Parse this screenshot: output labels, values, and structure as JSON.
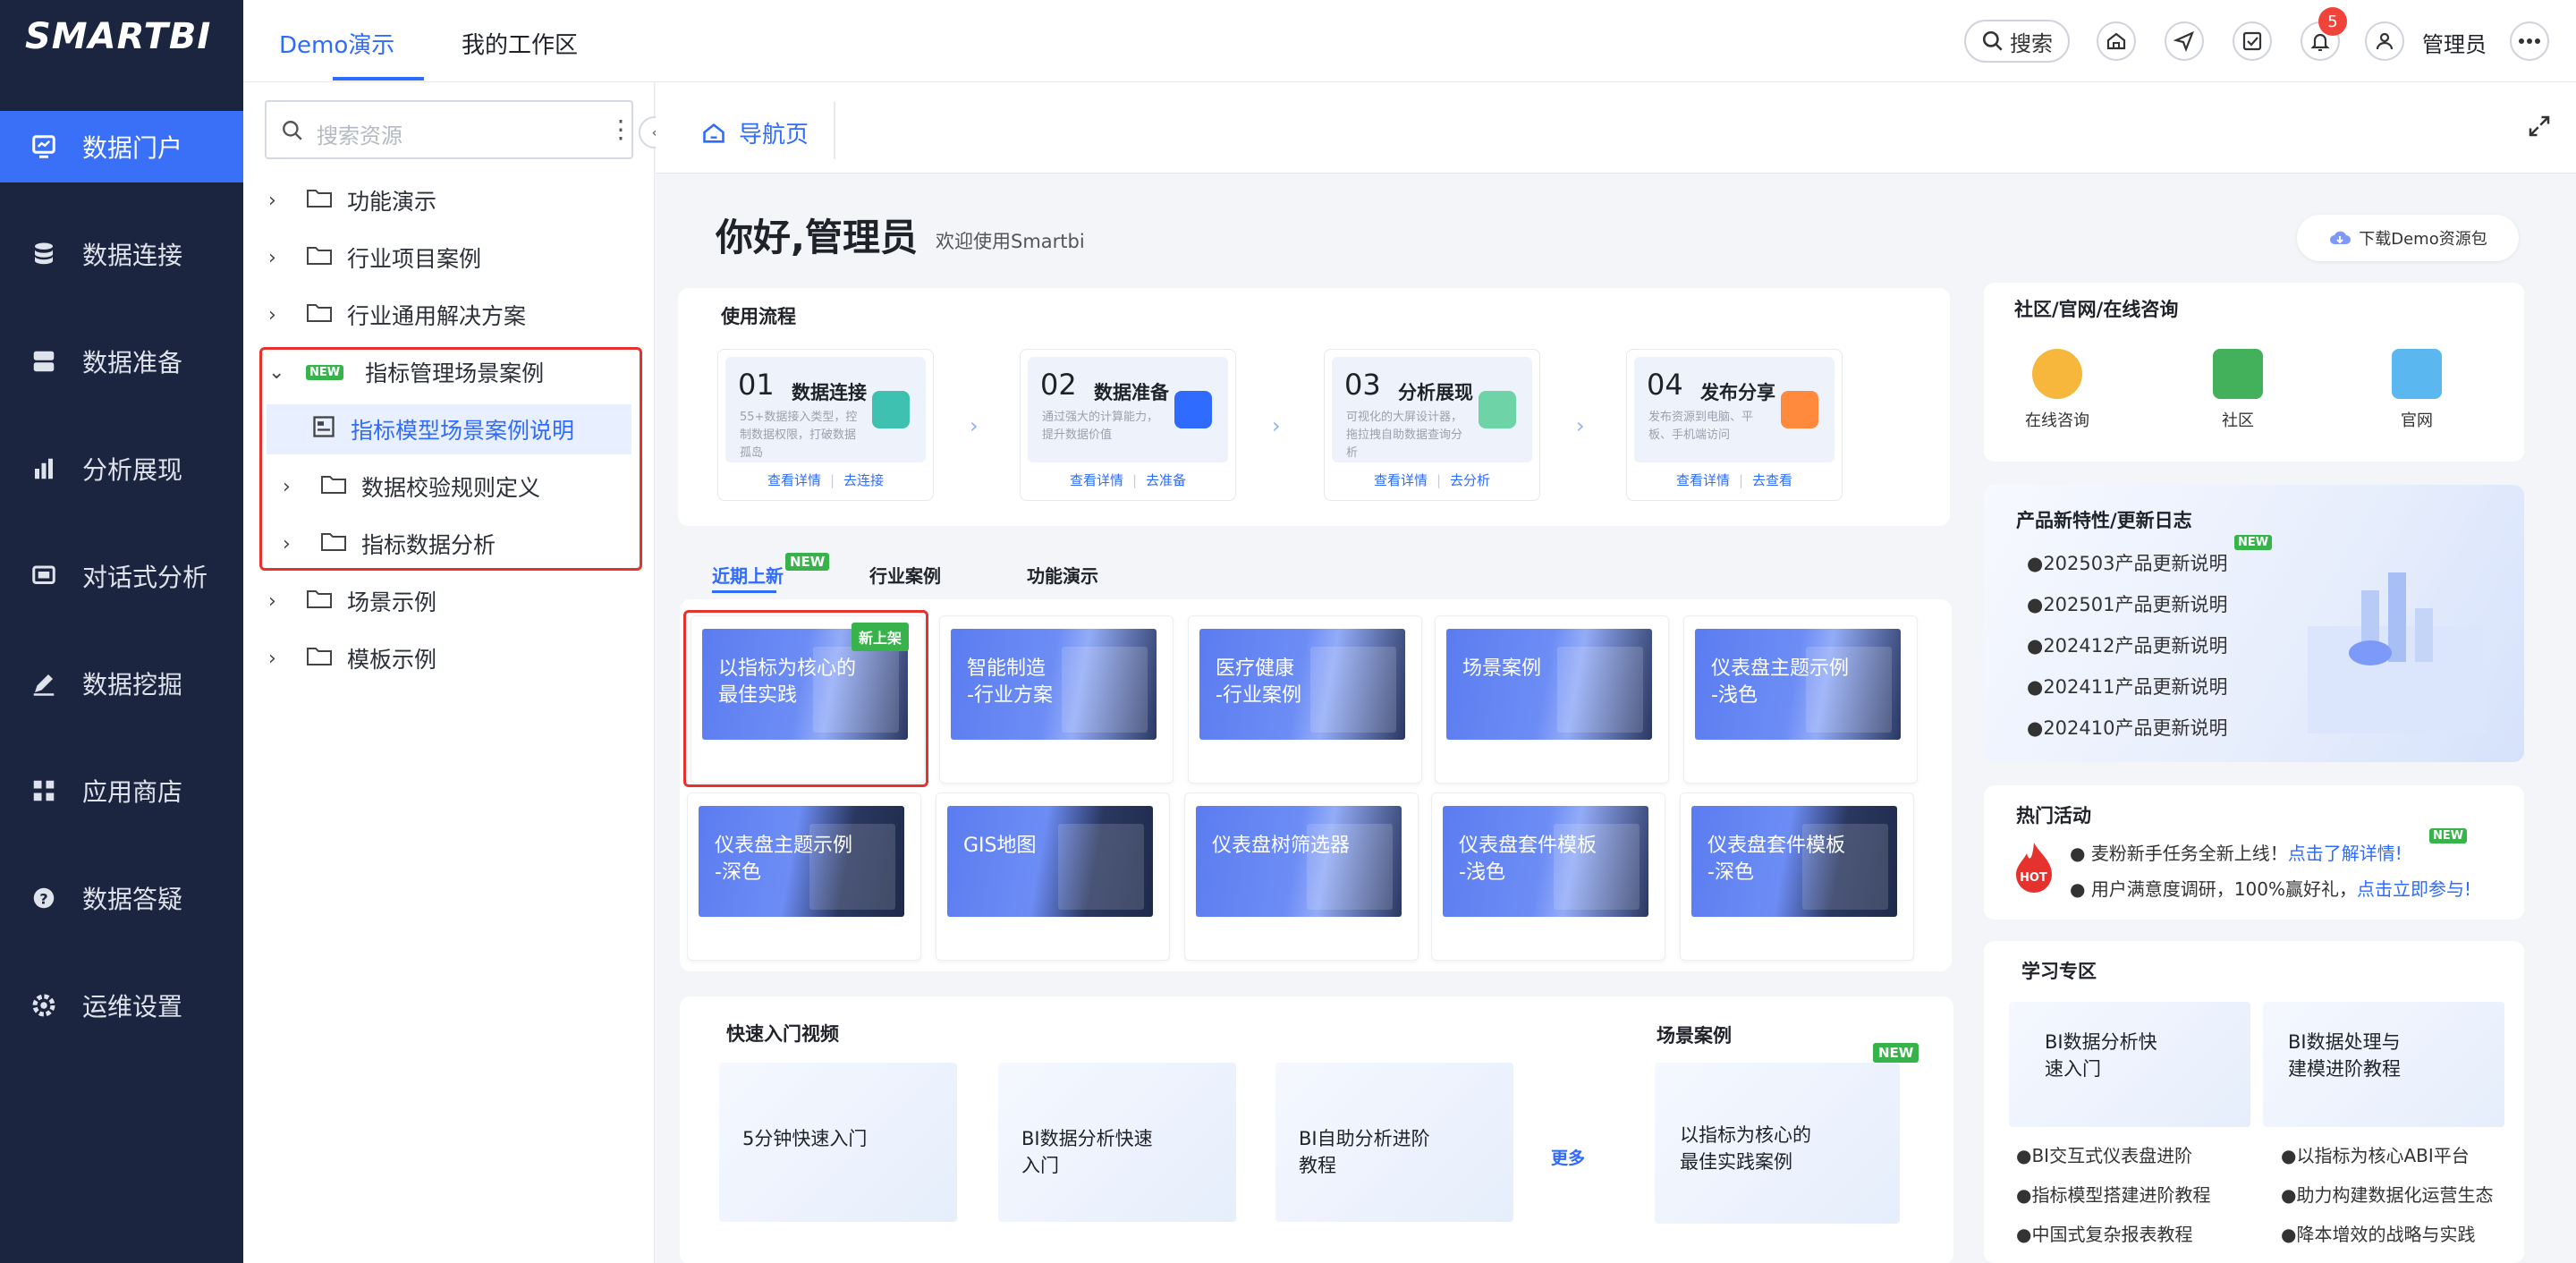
{
  "app": {
    "logo": "SMARTBI"
  },
  "nav": [
    {
      "label": "数据门户",
      "icon": "portal-icon",
      "active": true
    },
    {
      "label": "数据连接",
      "icon": "database-icon"
    },
    {
      "label": "数据准备",
      "icon": "server-icon"
    },
    {
      "label": "分析展现",
      "icon": "bar-chart-icon"
    },
    {
      "label": "对话式分析",
      "icon": "chat-icon"
    },
    {
      "label": "数据挖掘",
      "icon": "pen-icon"
    },
    {
      "label": "应用商店",
      "icon": "apps-icon"
    },
    {
      "label": "数据答疑",
      "icon": "question-icon"
    },
    {
      "label": "运维设置",
      "icon": "gear-icon"
    }
  ],
  "topbar": {
    "tabs": [
      "Demo演示",
      "我的工作区"
    ],
    "search": "搜索",
    "badge": "5",
    "user": "管理员"
  },
  "tree": {
    "search_placeholder": "搜索资源",
    "items": [
      "功能演示",
      "行业项目案例",
      "行业通用解决方案",
      "指标管理场景案例",
      "指标模型场景案例说明",
      "数据校验规则定义",
      "指标数据分析",
      "场景示例",
      "模板示例"
    ],
    "new_tag": "NEW"
  },
  "breadcrumb": "导航页",
  "welcome": {
    "title": "你好,管理员",
    "subtitle": "欢迎使用Smartbi",
    "download": "下载Demo资源包"
  },
  "flow": {
    "title": "使用流程",
    "steps": [
      {
        "num": "01",
        "title": "数据连接",
        "desc": "55+数据接入类型，控制数据权限，打破数据孤岛",
        "links": [
          "查看详情",
          "去连接"
        ]
      },
      {
        "num": "02",
        "title": "数据准备",
        "desc": "通过强大的计算能力，提升数据价值",
        "links": [
          "查看详情",
          "去准备"
        ]
      },
      {
        "num": "03",
        "title": "分析展现",
        "desc": "可视化的大屏设计器，拖拉拽自助数据查询分析",
        "links": [
          "查看详情",
          "去分析"
        ]
      },
      {
        "num": "04",
        "title": "发布分享",
        "desc": "发布资源到电脑、平板、手机端访问",
        "links": [
          "查看详情",
          "去查看"
        ]
      }
    ]
  },
  "cases": {
    "tabs": [
      "近期上新",
      "行业案例",
      "功能演示"
    ],
    "new_tag": "NEW",
    "new_badge": "新上架",
    "items": [
      "以指标为核心的\n最佳实践",
      "智能制造\n-行业方案",
      "医疗健康\n-行业案例",
      "场景案例",
      "仪表盘主题示例\n-浅色",
      "仪表盘主题示例\n-深色",
      "GIS地图",
      "仪表盘树筛选器",
      "仪表盘套件模板\n-浅色",
      "仪表盘套件模板\n-深色"
    ]
  },
  "videos": {
    "title": "快速入门视频",
    "items": [
      "5分钟快速入门",
      "BI数据分析快速\n入门",
      "BI自助分析进阶\n教程"
    ],
    "more": "更多",
    "scene_title": "场景案例",
    "scene_item": "以指标为核心的\n最佳实践案例",
    "scene_new": "NEW"
  },
  "community": {
    "title": "社区/官网/在线咨询",
    "items": [
      "在线咨询",
      "社区",
      "官网"
    ]
  },
  "updates": {
    "title": "产品新特性/更新日志",
    "items": [
      "●202503产品更新说明",
      "●202501产品更新说明",
      "●202412产品更新说明",
      "●202411产品更新说明",
      "●202410产品更新说明"
    ],
    "new_tag": "NEW"
  },
  "events": {
    "title": "热门活动",
    "hot": "HOT",
    "new_tag": "NEW",
    "items": [
      {
        "text": "麦粉新手任务全新上线！",
        "link": "点击了解详情!"
      },
      {
        "text": "用户满意度调研，100%赢好礼，",
        "link": "点击立即参与!"
      }
    ]
  },
  "learn": {
    "title": "学习专区",
    "cards": [
      "BI数据分析快\n速入门",
      "BI数据处理与\n建模进阶教程"
    ],
    "col1": [
      "●BI交互式仪表盘进阶",
      "●指标模型搭建进阶教程",
      "●中国式复杂报表教程"
    ],
    "col2": [
      "●以指标为核心ABI平台",
      "●助力构建数据化运营生态",
      "●降本增效的战略与实践"
    ]
  },
  "colors": {
    "accent": "#2f6bff",
    "nav_bg": "#1c2540",
    "nav_active": "#3a6ff7",
    "highlight": "#e5322e",
    "new_green": "#38b24a"
  }
}
